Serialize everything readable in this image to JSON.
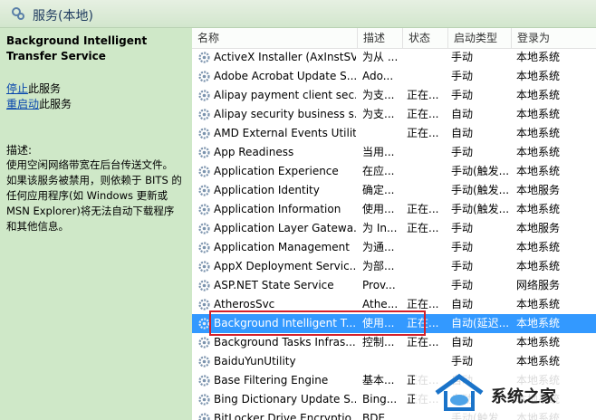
{
  "window": {
    "title": "服务(本地)",
    "icon": "services-gear-icon"
  },
  "left_panel": {
    "service_title": "Background Intelligent Transfer Service",
    "stop_link": "停止",
    "stop_suffix": "此服务",
    "restart_link": "重启动",
    "restart_suffix": "此服务",
    "description_label": "描述:",
    "description_lines": [
      "使用空闲网络带宽在后台传送文件。",
      "如果该服务被禁用，则依赖于 BITS 的",
      "任何应用程序(如 Windows 更新或",
      "MSN Explorer)将无法自动下载程序",
      "和其他信息。"
    ]
  },
  "columns": {
    "name": "名称",
    "description": "描述",
    "status": "状态",
    "startup": "启动类型",
    "login": "登录为"
  },
  "services": [
    {
      "name": "ActiveX Installer (AxInstSV)",
      "description": "为从 ...",
      "status": "",
      "startup": "手动",
      "login": "本地系统"
    },
    {
      "name": "Adobe Acrobat Update S...",
      "description": "Ado...",
      "status": "",
      "startup": "手动",
      "login": "本地系统"
    },
    {
      "name": "Alipay payment client sec...",
      "description": "为支...",
      "status": "正在...",
      "startup": "手动",
      "login": "本地系统"
    },
    {
      "name": "Alipay security business s...",
      "description": "为支...",
      "status": "正在...",
      "startup": "自动",
      "login": "本地系统"
    },
    {
      "name": "AMD External Events Utility",
      "description": "",
      "status": "正在...",
      "startup": "自动",
      "login": "本地系统"
    },
    {
      "name": "App Readiness",
      "description": "当用...",
      "status": "",
      "startup": "手动",
      "login": "本地系统"
    },
    {
      "name": "Application Experience",
      "description": "在应...",
      "status": "",
      "startup": "手动(触发...",
      "login": "本地系统"
    },
    {
      "name": "Application Identity",
      "description": "确定...",
      "status": "",
      "startup": "手动(触发...",
      "login": "本地服务"
    },
    {
      "name": "Application Information",
      "description": "使用...",
      "status": "正在...",
      "startup": "手动(触发...",
      "login": "本地系统"
    },
    {
      "name": "Application Layer Gatewa...",
      "description": "为 In...",
      "status": "正在...",
      "startup": "手动",
      "login": "本地服务"
    },
    {
      "name": "Application Management",
      "description": "为通...",
      "status": "",
      "startup": "手动",
      "login": "本地系统"
    },
    {
      "name": "AppX Deployment Servic...",
      "description": "为部...",
      "status": "",
      "startup": "手动",
      "login": "本地系统"
    },
    {
      "name": "ASP.NET State Service",
      "description": "Prov...",
      "status": "",
      "startup": "手动",
      "login": "网络服务"
    },
    {
      "name": "AtherosSvc",
      "description": "Athe...",
      "status": "正在...",
      "startup": "自动",
      "login": "本地系统"
    },
    {
      "name": "Background Intelligent T...",
      "description": "使用...",
      "status": "正在...",
      "startup": "自动(延迟...",
      "login": "本地系统",
      "selected": true
    },
    {
      "name": "Background Tasks Infras...",
      "description": "控制...",
      "status": "正在...",
      "startup": "自动",
      "login": "本地系统"
    },
    {
      "name": "BaiduYunUtility",
      "description": "",
      "status": "",
      "startup": "手动",
      "login": "本地系统"
    },
    {
      "name": "Base Filtering Engine",
      "description": "基本...",
      "status": "正在...",
      "startup": "自动",
      "login": "本地系统"
    },
    {
      "name": "Bing Dictionary Update S...",
      "description": "Bing...",
      "status": "正在...",
      "startup": "自动",
      "login": "本地系统"
    },
    {
      "name": "BitLocker Drive Encryptio...",
      "description": "BDE...",
      "status": "",
      "startup": "手动(触发...",
      "login": "本地系统"
    }
  ],
  "watermark": {
    "text": "系统之家",
    "logo": "house-logo-icon"
  },
  "colors": {
    "selected_row": "#3399ff",
    "highlight_border": "#d3202b",
    "left_panel_bg": "#cfe8c8"
  }
}
